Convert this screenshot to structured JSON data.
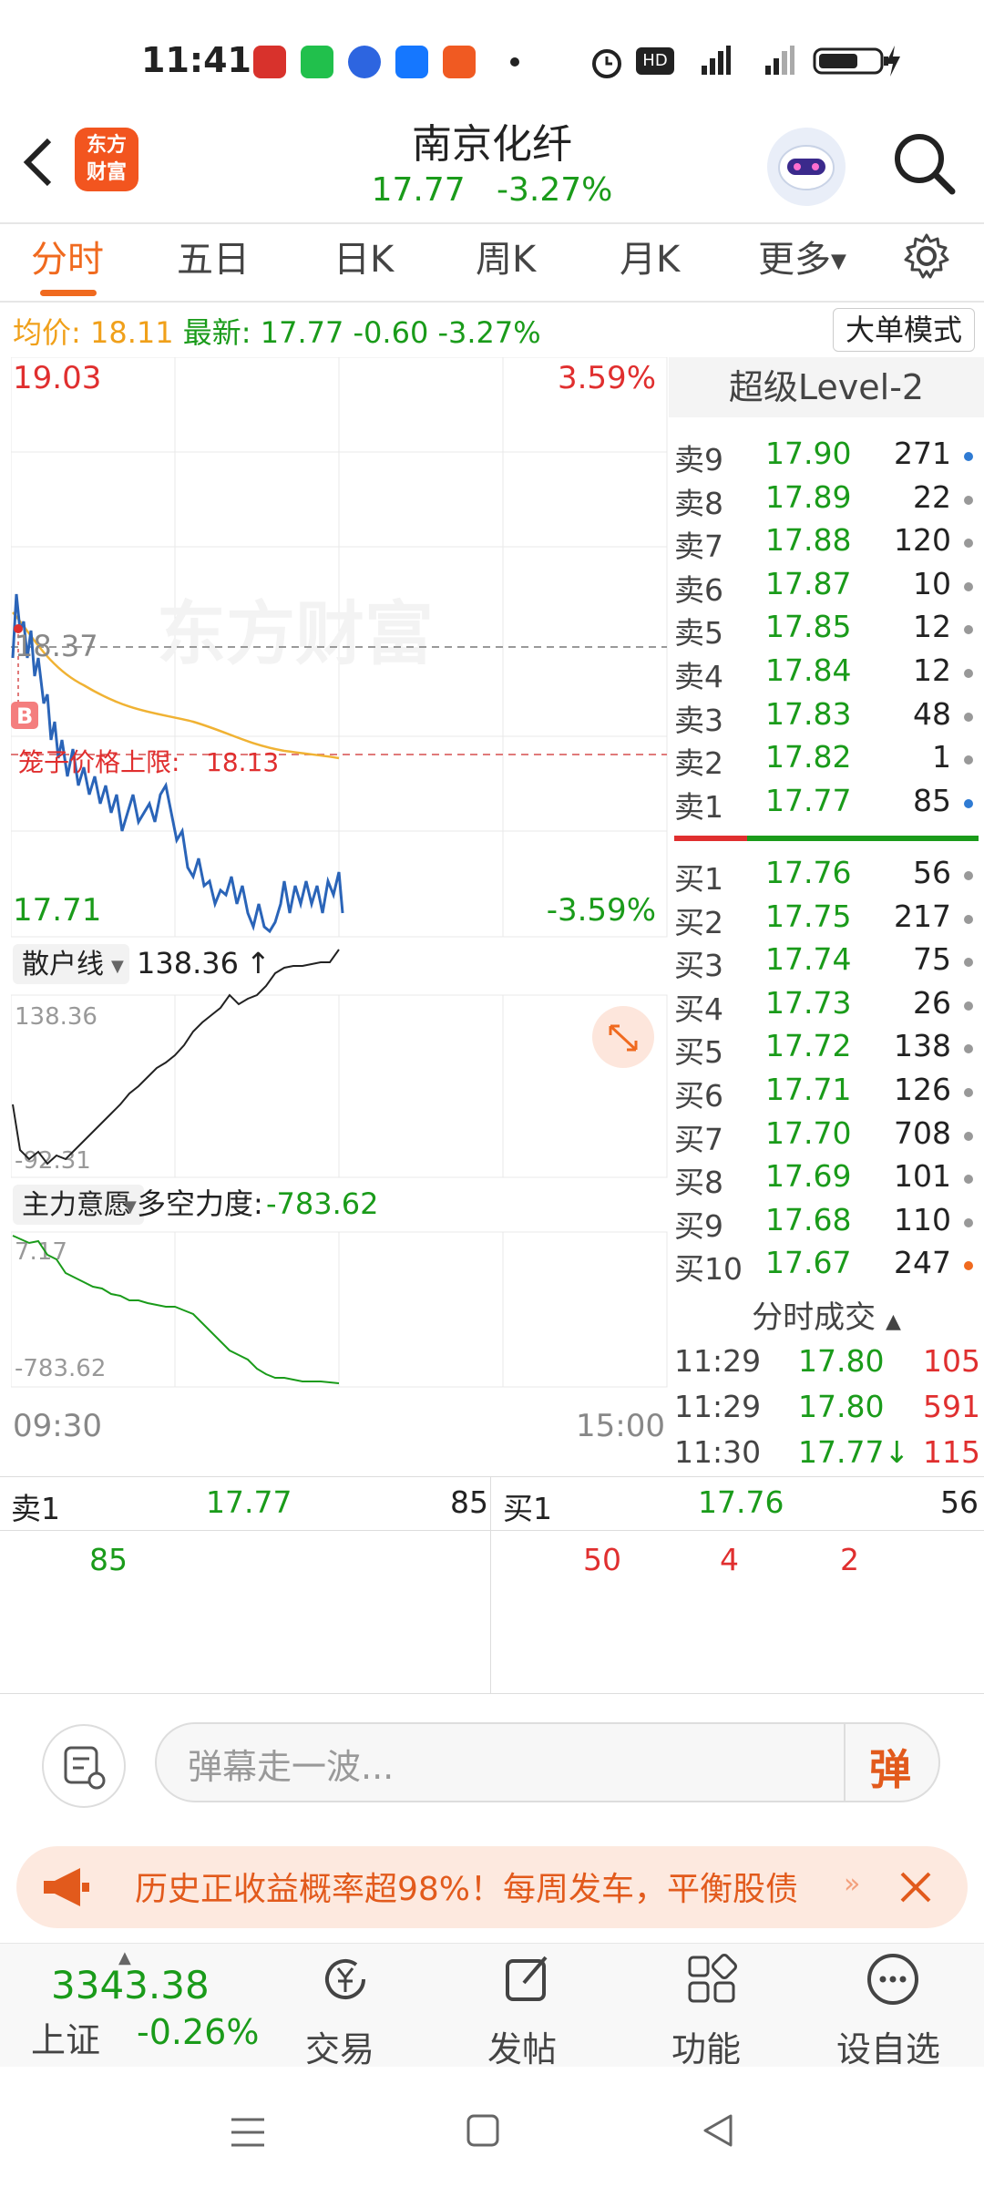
{
  "status_bar": {
    "time": "11:41"
  },
  "header": {
    "logo": "东方\n财富",
    "stock_name": "南京化纤",
    "price": "17.77",
    "change_pct": "-3.27%"
  },
  "tabs": [
    "分时",
    "五日",
    "日K",
    "周K",
    "月K",
    "更多"
  ],
  "info": {
    "avg_label": "均价:",
    "avg_value": "18.11",
    "latest_label": "最新:",
    "latest_value": "17.77",
    "change": "-0.60",
    "change_pct": "-3.27%",
    "big_order_button": "大单模式"
  },
  "chart_labels": {
    "high": "19.03",
    "high_pct": "3.59%",
    "low": "17.71",
    "low_pct": "-3.59%",
    "ref_price": "18.37",
    "cage_limit": "笼子价格上限:",
    "cage_limit_value": "18.13",
    "watermark": "东方财富",
    "buy_marker": "B",
    "start_time": "09:30",
    "end_time": "15:00"
  },
  "retail_panel": {
    "select": "散户线",
    "value": "138.36",
    "max": "138.36",
    "min": "-92.31"
  },
  "main_panel": {
    "select": "主力意愿",
    "label": "多空力度:",
    "value": "-783.62",
    "max": "7.17",
    "min": "-783.62"
  },
  "level2": {
    "title": "超级Level-2",
    "asks": [
      {
        "label": "卖9",
        "price": "17.90",
        "vol": "271",
        "dot": "#2f7bd3"
      },
      {
        "label": "卖8",
        "price": "17.89",
        "vol": "22",
        "dot": "#999999"
      },
      {
        "label": "卖7",
        "price": "17.88",
        "vol": "120",
        "dot": "#999999"
      },
      {
        "label": "卖6",
        "price": "17.87",
        "vol": "10",
        "dot": "#999999"
      },
      {
        "label": "卖5",
        "price": "17.85",
        "vol": "12",
        "dot": "#999999"
      },
      {
        "label": "卖4",
        "price": "17.84",
        "vol": "12",
        "dot": "#999999"
      },
      {
        "label": "卖3",
        "price": "17.83",
        "vol": "48",
        "dot": "#999999"
      },
      {
        "label": "卖2",
        "price": "17.82",
        "vol": "1",
        "dot": "#999999"
      },
      {
        "label": "卖1",
        "price": "17.77",
        "vol": "85",
        "dot": "#2f7bd3"
      }
    ],
    "bids": [
      {
        "label": "买1",
        "price": "17.76",
        "vol": "56",
        "dot": "#999999"
      },
      {
        "label": "买2",
        "price": "17.75",
        "vol": "217",
        "dot": "#999999"
      },
      {
        "label": "买3",
        "price": "17.74",
        "vol": "75",
        "dot": "#999999"
      },
      {
        "label": "买4",
        "price": "17.73",
        "vol": "26",
        "dot": "#999999"
      },
      {
        "label": "买5",
        "price": "17.72",
        "vol": "138",
        "dot": "#999999"
      },
      {
        "label": "买6",
        "price": "17.71",
        "vol": "126",
        "dot": "#999999"
      },
      {
        "label": "买7",
        "price": "17.70",
        "vol": "708",
        "dot": "#999999"
      },
      {
        "label": "买8",
        "price": "17.69",
        "vol": "101",
        "dot": "#999999"
      },
      {
        "label": "买9",
        "price": "17.68",
        "vol": "110",
        "dot": "#999999"
      },
      {
        "label": "买10",
        "price": "17.67",
        "vol": "247",
        "dot": "#f06a1f"
      }
    ],
    "trades_title": "分时成交",
    "trades": [
      {
        "time": "11:29",
        "price": "17.80",
        "vol": "105",
        "color": "#e02f2f"
      },
      {
        "time": "11:29",
        "price": "17.80",
        "vol": "591",
        "color": "#e02f2f"
      },
      {
        "time": "11:30",
        "price": "17.77↓",
        "vol": "115",
        "color": "#e02f2f"
      }
    ]
  },
  "queue": {
    "sell_label": "卖1",
    "sell_price": "17.77",
    "sell_vol": "85",
    "buy_label": "买1",
    "buy_price": "17.76",
    "buy_vol": "56",
    "sell_orders": [
      "85"
    ],
    "buy_orders": [
      "50",
      "4",
      "2"
    ]
  },
  "danmu": {
    "placeholder": "弹幕走一波...",
    "button": "弹"
  },
  "ad": {
    "text": "历史正收益概率超98%！每周发车，平衡股债"
  },
  "bottom_nav": {
    "index_value": "3343.38",
    "index_name": "上证",
    "index_change": "-0.26%",
    "items": [
      "交易",
      "发帖",
      "功能",
      "设自选"
    ]
  },
  "colors": {
    "up": "#e02f2f",
    "down": "#1a9b1a",
    "accent": "#f06a1f",
    "price_line": "#2a64b8",
    "avg_line": "#f0b233"
  }
}
